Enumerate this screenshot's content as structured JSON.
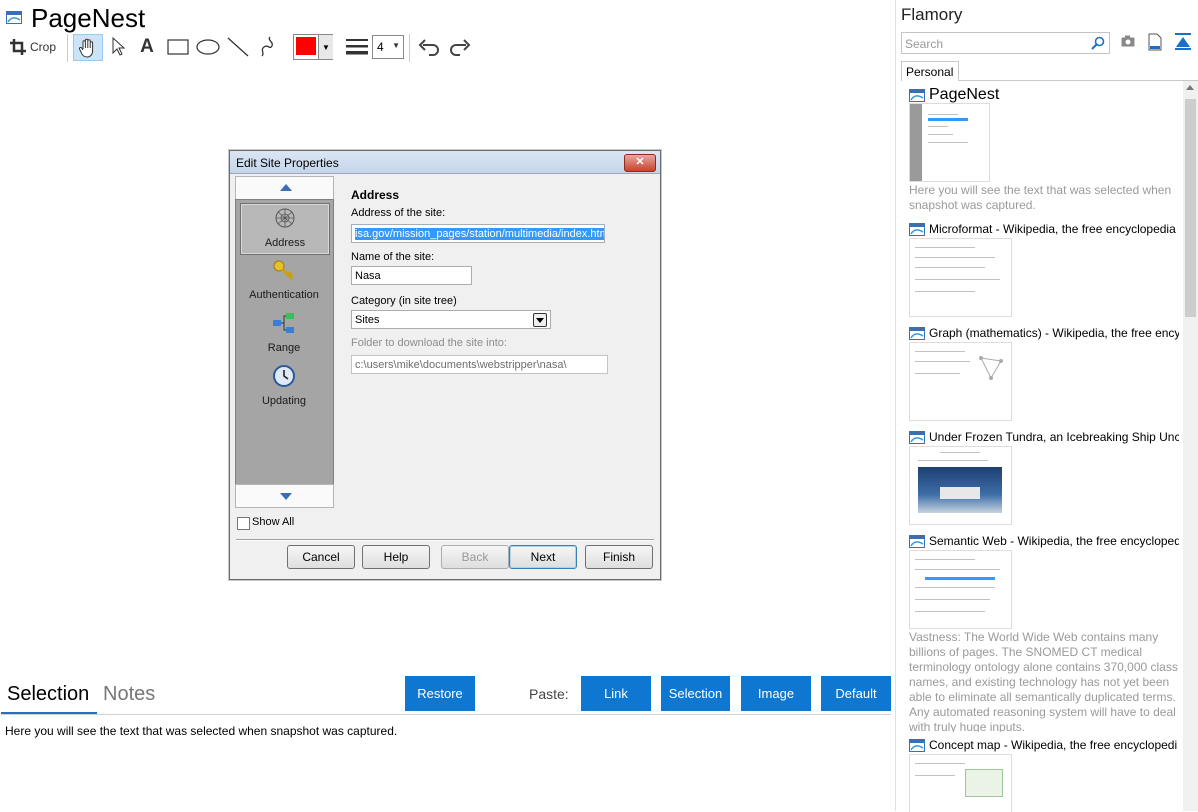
{
  "app": {
    "title": "PageNest"
  },
  "toolbar": {
    "crop_label": "Crop",
    "line_width": "4",
    "color": "#ff0000"
  },
  "dialog": {
    "title": "Edit Site Properties",
    "close_label": "✕",
    "nav_items": [
      "Address",
      "Authentication",
      "Range",
      "Updating"
    ],
    "show_all_label": "Show All",
    "section_title": "Address",
    "address_label": "Address of the site:",
    "address_value": "isa.gov/mission_pages/station/multimedia/index.htm",
    "name_label": "Name of the site:",
    "name_value": "Nasa",
    "category_label": "Category (in site tree)",
    "category_value": "Sites",
    "folder_label": "Folder to download the site into:",
    "folder_value": "c:\\users\\mike\\documents\\webstripper\\nasa\\",
    "buttons": {
      "cancel": "Cancel",
      "help": "Help",
      "back": "Back",
      "next": "Next",
      "finish": "Finish"
    }
  },
  "bottom": {
    "tabs": {
      "selection": "Selection",
      "notes": "Notes"
    },
    "restore_label": "Restore",
    "paste_label": "Paste:",
    "paste_buttons": {
      "link": "Link",
      "selection": "Selection",
      "image": "Image",
      "default": "Default"
    },
    "selection_text": "Here you will see the text that was selected when snapshot was captured."
  },
  "sidebar": {
    "title": "Flamory",
    "search_placeholder": "Search",
    "tab": "Personal",
    "snapshots": [
      {
        "title": "PageNest",
        "desc": "Here you will see the text that was selected when snapshot was captured."
      },
      {
        "title": "Microformat - Wikipedia, the free encyclopedia"
      },
      {
        "title": "Graph (mathematics) - Wikipedia, the free ency"
      },
      {
        "title": "Under Frozen Tundra, an Icebreaking Ship Unco"
      },
      {
        "title": "Semantic Web - Wikipedia, the free encycloped",
        "desc": "Vastness: The World Wide Web contains many billions of pages. The SNOMED CT medical terminology ontology alone contains 370,000 class names, and existing technology has not yet been able to eliminate all semantically duplicated terms. Any automated reasoning system will have to deal with truly huge inputs."
      },
      {
        "title": "Concept map - Wikipedia, the free encyclopedi"
      }
    ]
  },
  "colors": {
    "accent": "#0d77d1",
    "selection_tab_underline": "#1a73c8"
  }
}
